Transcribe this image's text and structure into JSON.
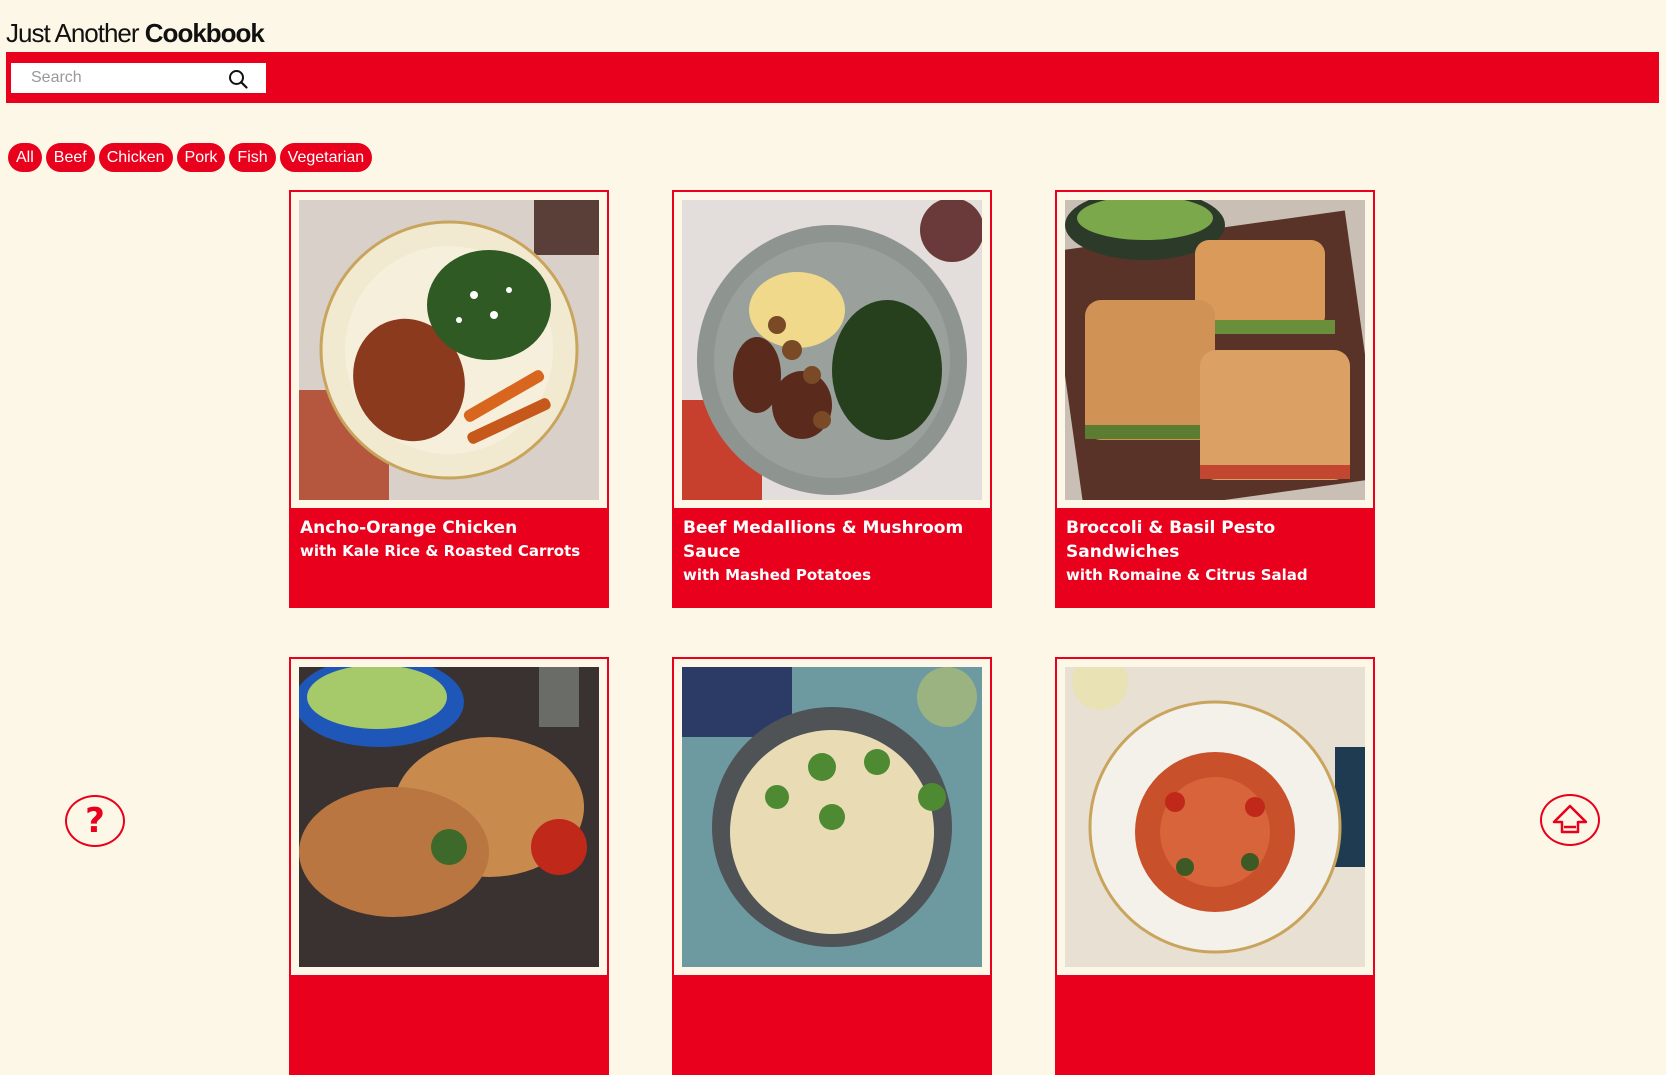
{
  "header": {
    "title_light": "Just Another",
    "title_bold": "Cookbook"
  },
  "search": {
    "placeholder": "Search",
    "value": "",
    "icon": "search-icon"
  },
  "filters": [
    "All",
    "Beef",
    "Chicken",
    "Pork",
    "Fish",
    "Vegetarian"
  ],
  "colors": {
    "accent": "#e8001c",
    "background": "#fcf7e6"
  },
  "recipes": [
    {
      "title": "Ancho-Orange Chicken",
      "subtitle": "with Kale Rice & Roasted Carrots"
    },
    {
      "title": "Beef Medallions & Mushroom Sauce",
      "subtitle": "with Mashed Potatoes"
    },
    {
      "title": "Broccoli & Basil Pesto Sandwiches",
      "subtitle": "with Romaine & Citrus Salad"
    },
    {
      "title": "",
      "subtitle": ""
    },
    {
      "title": "",
      "subtitle": ""
    },
    {
      "title": "",
      "subtitle": ""
    }
  ],
  "buttons": {
    "help_icon": "question-mark-icon",
    "back_to_top_icon": "arrow-up-icon",
    "help_glyph": "?"
  }
}
